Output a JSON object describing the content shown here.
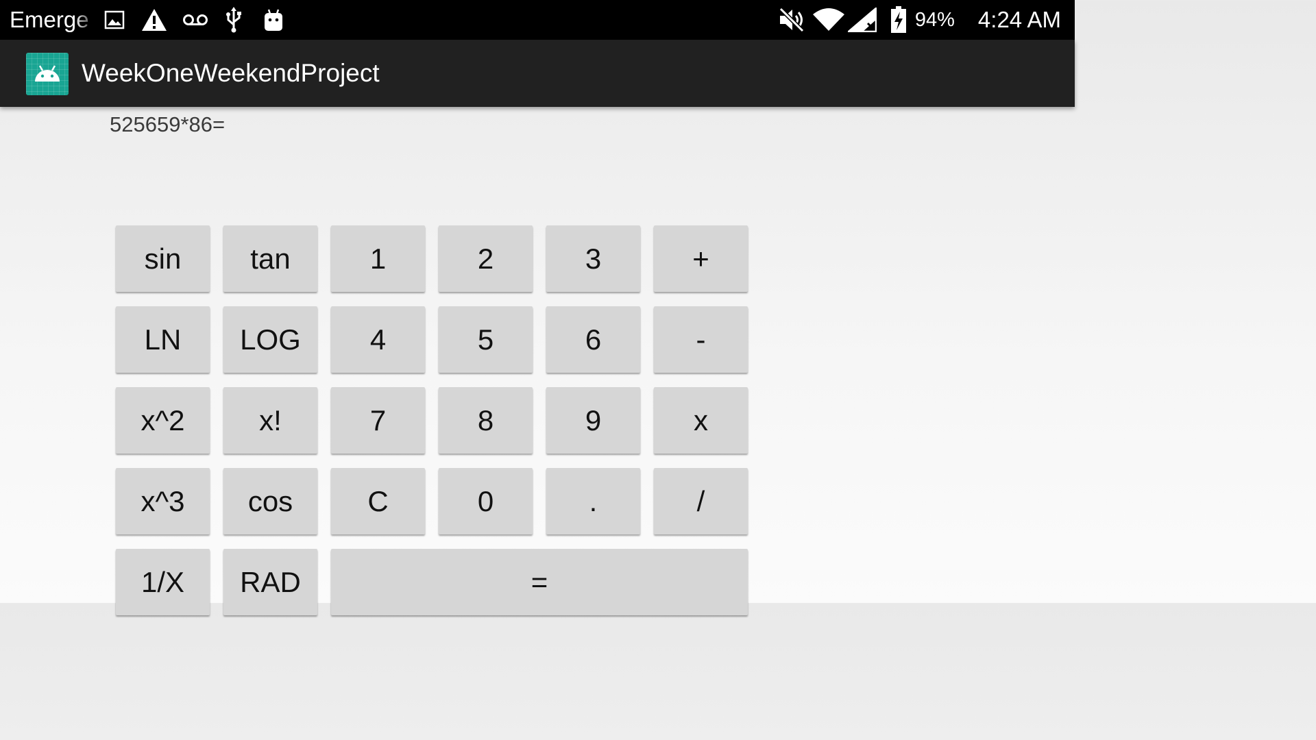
{
  "status_bar": {
    "carrier": "Emerge",
    "battery_percent": "94%",
    "time": "4:24 AM",
    "left_icons": [
      "gallery-icon",
      "warning-icon",
      "voicemail-icon",
      "usb-icon",
      "android-debug-icon"
    ],
    "right_icons": [
      "mute-icon",
      "wifi-icon",
      "signal-no-service-icon",
      "battery-charging-icon"
    ]
  },
  "app_bar": {
    "title": "WeekOneWeekendProject",
    "icon": "android-launcher-icon",
    "icon_color": "#19a593"
  },
  "display": {
    "expression": "525659*86="
  },
  "keypad": {
    "rows": [
      [
        "sin",
        "tan",
        "1",
        "2",
        "3",
        "+"
      ],
      [
        "LN",
        "LOG",
        "4",
        "5",
        "6",
        "-"
      ],
      [
        "x^2",
        "x!",
        "7",
        "8",
        "9",
        "x"
      ],
      [
        "x^3",
        "cos",
        "C",
        "0",
        ".",
        "/"
      ],
      [
        "1/X",
        "RAD",
        "="
      ]
    ]
  },
  "colors": {
    "status_bar": "#000000",
    "action_bar": "#212121",
    "key_background": "#d6d6d6",
    "background": "#f0f0f0"
  }
}
